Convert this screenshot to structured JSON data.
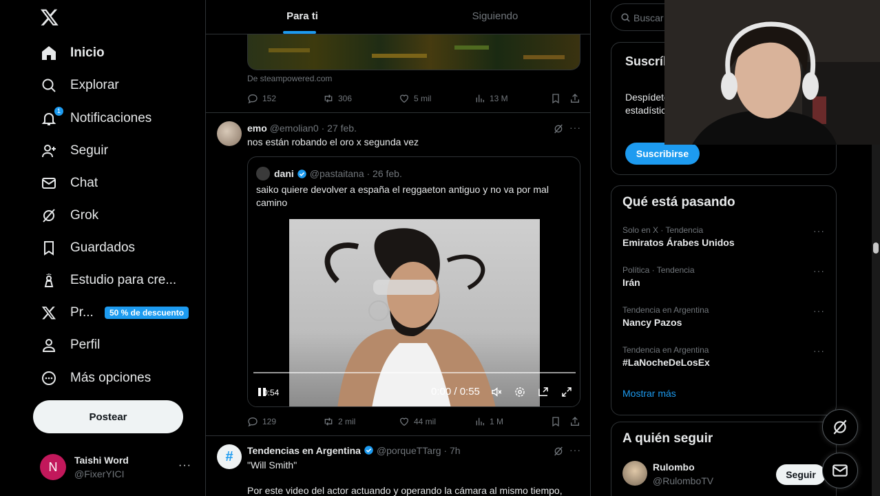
{
  "sidebar": {
    "items": [
      {
        "label": "Inicio"
      },
      {
        "label": "Explorar"
      },
      {
        "label": "Notificaciones",
        "badge": "1"
      },
      {
        "label": "Seguir"
      },
      {
        "label": "Chat"
      },
      {
        "label": "Grok"
      },
      {
        "label": "Guardados"
      },
      {
        "label": "Estudio para cre..."
      },
      {
        "label": "Pr...",
        "badge": "50 % de descuento"
      },
      {
        "label": "Perfil"
      },
      {
        "label": "Más opciones"
      }
    ],
    "post_label": "Postear",
    "account": {
      "initial": "N",
      "name": "Taishi Word",
      "handle": "@FixerYICI",
      "more": "···",
      "avatar_color": "#c2185b"
    }
  },
  "main": {
    "tabs": [
      {
        "label": "Para ti"
      },
      {
        "label": "Siguiendo"
      }
    ],
    "prev_post": {
      "source": "De steampowered.com",
      "replies": "152",
      "reposts": "306",
      "likes": "5 mil",
      "views": "13 M"
    },
    "tweet1": {
      "name": "emo",
      "meta": "@emolian0 · 27 feb.",
      "text": "nos están robando el oro x segunda vez",
      "quote": {
        "name": "dani",
        "meta": "@pastaitana · 26 feb.",
        "text": "saiko quiere devolver a españa el reggaeton antiguo y no va por mal camino",
        "video": {
          "time": "0:00 / 0:55",
          "remaining": "0:54",
          "progress": 0.0
        }
      },
      "replies": "129",
      "reposts": "2 mil",
      "likes": "44 mil",
      "views": "1 M"
    },
    "tweet2": {
      "name": "Tendencias en Argentina",
      "meta": "@porqueTTarg · 7h",
      "text1": "\"Will Smith\"",
      "text2": "Por este video del actor actuando y operando la cámara al mismo tiempo,"
    },
    "more": "···"
  },
  "right": {
    "search_placeholder": "Buscar",
    "premium": {
      "title": "Suscríbete a Premium",
      "desc": "Despídete de los anuncios, accede a estadísticas y aprovecha al máximo X.",
      "button": "Suscribirse"
    },
    "trends_title": "Qué está pasando",
    "trends": [
      {
        "context": "Solo en X · Tendencia",
        "name": "Emiratos Árabes Unidos"
      },
      {
        "context": "Política · Tendencia",
        "name": "Irán"
      },
      {
        "context": "Tendencia en Argentina",
        "name": "Nancy Pazos"
      },
      {
        "context": "Tendencia en Argentina",
        "name": "#LaNocheDeLosEx"
      }
    ],
    "show_more": "Mostrar más",
    "follow_title": "A quién seguir",
    "follow": {
      "name": "Rulombo",
      "handle": "@RulomboTV",
      "button": "Seguir"
    }
  },
  "colors": {
    "accent": "#1d9bf0",
    "text": "#e7e9ea",
    "muted": "#71767b",
    "border": "#2f3336",
    "background": "#000000"
  }
}
